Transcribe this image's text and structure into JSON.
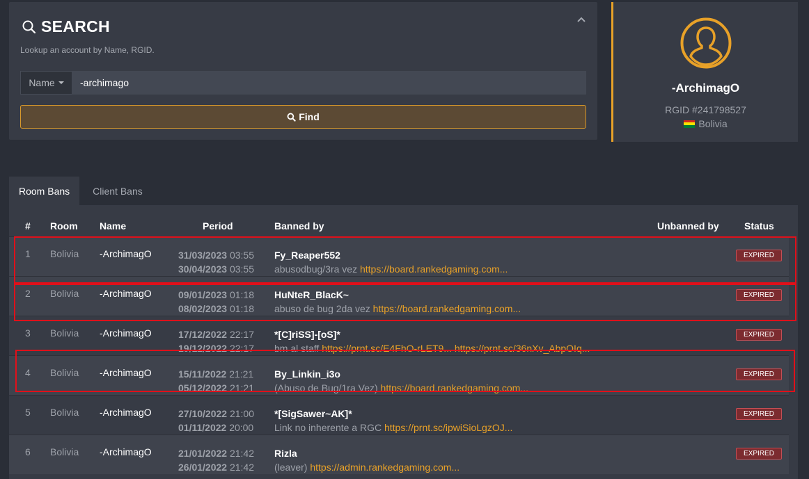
{
  "search": {
    "title": "SEARCH",
    "subtitle": "Lookup an account by Name, RGID.",
    "type_label": "Name",
    "query_value": "-archimago",
    "find_label": "Find"
  },
  "profile": {
    "name": "-ArchimagO",
    "rgid": "RGID #241798527",
    "country": "Bolivia"
  },
  "tabs": [
    {
      "label": "Room Bans",
      "active": true
    },
    {
      "label": "Client Bans",
      "active": false
    }
  ],
  "table": {
    "headers": {
      "num": "#",
      "room": "Room",
      "name": "Name",
      "period": "Period",
      "banned_by": "Banned by",
      "unbanned_by": "Unbanned by",
      "status": "Status"
    },
    "rows": [
      {
        "num": "1",
        "room": "Bolivia",
        "name": "-ArchimagO",
        "start_date": "31/03/2023",
        "start_time": "03:55",
        "end_date": "30/04/2023",
        "end_time": "03:55",
        "banned_by": "Fy_Reaper552",
        "reason": "abusodbug/3ra vez",
        "link": "https://board.rankedgaming.com...",
        "link2": "",
        "status": "EXPIRED"
      },
      {
        "num": "2",
        "room": "Bolivia",
        "name": "-ArchimagO",
        "start_date": "09/01/2023",
        "start_time": "01:18",
        "end_date": "08/02/2023",
        "end_time": "01:18",
        "banned_by": "HuNteR_BlacK~",
        "reason": "abuso de bug 2da vez",
        "link": "https://board.rankedgaming.com...",
        "link2": "",
        "status": "EXPIRED"
      },
      {
        "num": "3",
        "room": "Bolivia",
        "name": "-ArchimagO",
        "start_date": "17/12/2022",
        "start_time": "22:17",
        "end_date": "19/12/2022",
        "end_time": "22:17",
        "banned_by": "*[C]riSS]-[oS]*",
        "reason": "bm al staff",
        "link": "https://prnt.sc/E4FhO-rLET9...",
        "link2": "https://prnt.sc/36nXv_AbpOIq...",
        "status": "EXPIRED"
      },
      {
        "num": "4",
        "room": "Bolivia",
        "name": "-ArchimagO",
        "start_date": "15/11/2022",
        "start_time": "21:21",
        "end_date": "05/12/2022",
        "end_time": "21:21",
        "banned_by": "By_Linkin_i3o",
        "reason": "(Abuso de Bug/1ra Vez)",
        "link": "https://board.rankedgaming.com...",
        "link2": "",
        "status": "EXPIRED"
      },
      {
        "num": "5",
        "room": "Bolivia",
        "name": "-ArchimagO",
        "start_date": "27/10/2022",
        "start_time": "21:00",
        "end_date": "01/11/2022",
        "end_time": "20:00",
        "banned_by": "*[SigSawer~AK]*",
        "reason": "Link no inherente a RGC",
        "link": "https://prnt.sc/ipwiSioLgzOJ...",
        "link2": "",
        "status": "EXPIRED"
      },
      {
        "num": "6",
        "room": "Bolivia",
        "name": "-ArchimagO",
        "start_date": "21/01/2022",
        "start_time": "21:42",
        "end_date": "26/01/2022",
        "end_time": "21:42",
        "banned_by": "Rizla",
        "reason": "(leaver)",
        "link": "https://admin.rankedgaming.com...",
        "link2": "",
        "status": "EXPIRED"
      }
    ]
  },
  "colors": {
    "accent": "#e8a128",
    "highlight": "#e0101a",
    "expired_badge": "#7c2b2f"
  }
}
